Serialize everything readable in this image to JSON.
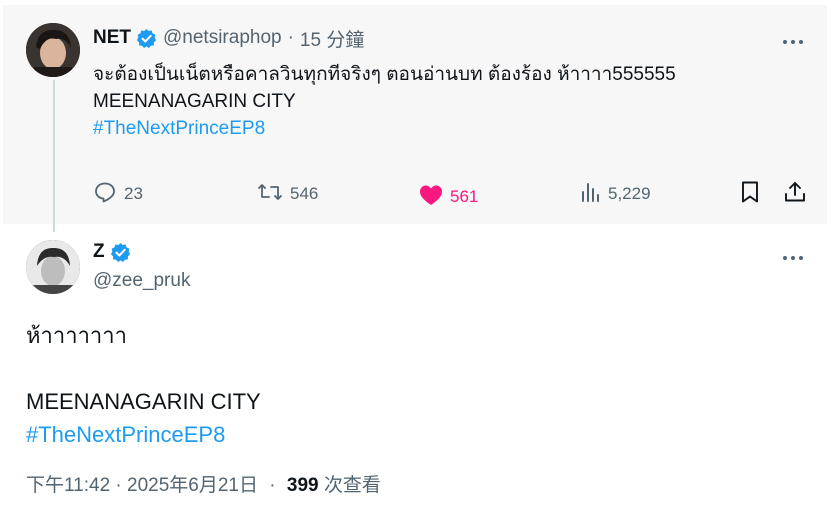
{
  "parent_tweet": {
    "author_name": "NET",
    "author_handle": "@netsiraphop",
    "separator": "·",
    "time_ago": "15 分鐘",
    "text_line1": "จะต้องเป็นเน็ตหรือคาลวินทุกทีจริงๆ ตอนอ่านบท ต้องร้อง ห้าาาา555555",
    "text_line2": "MEENANAGARIN CITY",
    "hashtag": "#TheNextPrinceEP8",
    "replies": "23",
    "reposts": "546",
    "likes": "561",
    "views": "5,229",
    "liked": true
  },
  "main_tweet": {
    "author_name": "Z",
    "author_handle": "@zee_pruk",
    "text_line1": "ห้าาาาาาา",
    "text_line2": "MEENANAGARIN CITY",
    "hashtag": "#TheNextPrinceEP8",
    "timestamp": "下午11:42 · 2025年6月21日",
    "separator": "·",
    "view_count": "399",
    "view_label": "次查看"
  },
  "icons": {
    "verified": "verified-badge-icon",
    "more": "more-icon",
    "reply": "reply-icon",
    "repost": "repost-icon",
    "like": "heart-icon",
    "views": "views-icon",
    "bookmark": "bookmark-icon",
    "share": "share-icon"
  },
  "colors": {
    "accent": "#1d9bf0",
    "like": "#f91880",
    "muted": "#536471",
    "text": "#0f1419",
    "parent_bg": "#f7f7f7"
  }
}
